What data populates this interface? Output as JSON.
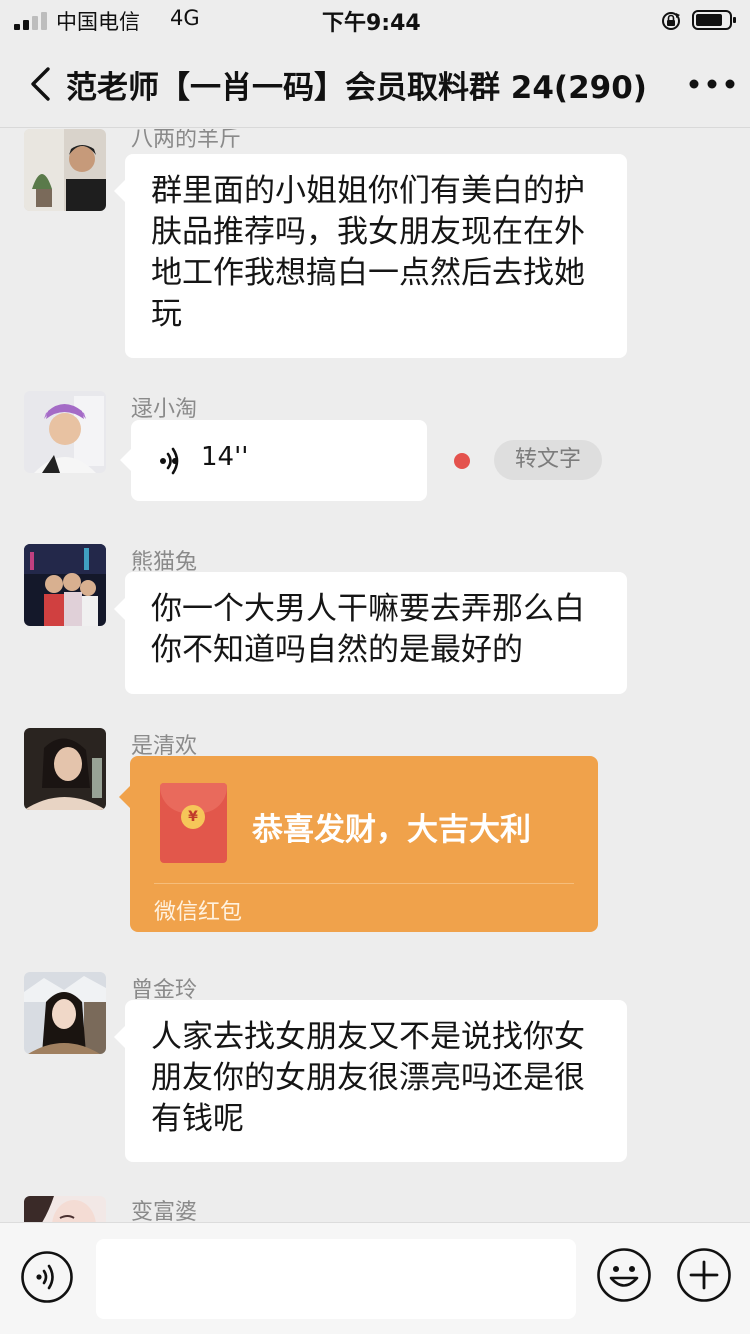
{
  "status_bar": {
    "carrier": "中国电信",
    "network": "4G",
    "time": "下午9:44",
    "icons": [
      "signal-icon",
      "rotation-lock-icon",
      "battery-icon"
    ]
  },
  "nav": {
    "title": "范老师【一肖一码】会员取料群 24(290)",
    "back_icon": "chevron-left-icon",
    "more_icon": "more-dots-icon"
  },
  "messages": [
    {
      "sender": "八两的羊斤",
      "type": "text",
      "text": "群里面的小姐姐你们有美白的护肤品推荐吗，我女朋友现在在外地工作我想搞白一点然后去找她玩"
    },
    {
      "sender": "逯小淘",
      "type": "voice",
      "duration": "14''",
      "to_text_label": "转文字",
      "unread": true
    },
    {
      "sender": "熊猫兔",
      "type": "text",
      "text": "你一个大男人干嘛要去弄那么白你不知道吗自然的是最好的"
    },
    {
      "sender": "是清欢",
      "type": "red_packet",
      "text": "恭喜发财，大吉大利",
      "label": "微信红包",
      "coin_symbol": "¥"
    },
    {
      "sender": "曾金玲",
      "type": "text",
      "text": "人家去找女朋友又不是说找你女朋友你的女朋友很漂亮吗还是很有钱呢"
    },
    {
      "sender": "变富婆",
      "type": "text",
      "text": ""
    }
  ],
  "input_bar": {
    "placeholder": "",
    "icons": [
      "voice-toggle-icon",
      "emoji-icon",
      "plus-icon"
    ]
  },
  "colors": {
    "background": "#ededed",
    "bubble": "#ffffff",
    "red_packet": "#f0a24b",
    "unread_dot": "#e4524d"
  }
}
